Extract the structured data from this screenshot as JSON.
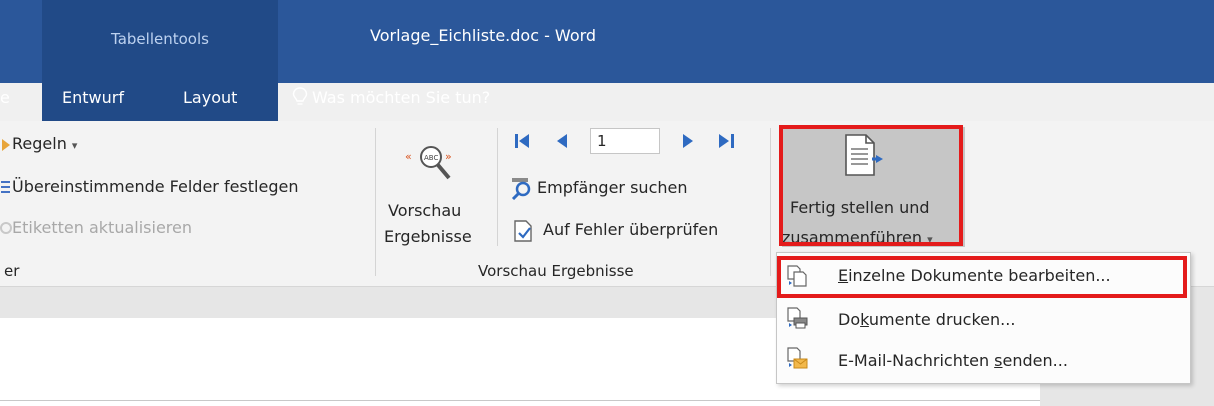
{
  "titlebar": {
    "context_tab": "Tabellentools",
    "title": "Vorlage_Eichliste.doc  -  Word"
  },
  "tabs": {
    "prev_fragment": "e",
    "entwurf": "Entwurf",
    "layout": "Layout",
    "tell_me": "Was möchten Sie tun?"
  },
  "ribbon": {
    "rules": "Regeln",
    "match_fields": "Übereinstimmende Felder festlegen",
    "update_labels": "Etiketten aktualisieren",
    "group_partial": "er",
    "preview_line1": "Vorschau",
    "preview_line2": "Ergebnisse",
    "record_number": "1",
    "find_recipient": "Empfänger suchen",
    "check_errors": "Auf Fehler überprüfen",
    "preview_group": "Vorschau Ergebnisse",
    "finish_line1": "Fertig stellen und",
    "finish_line2": "zusammenführen"
  },
  "menu": {
    "items": [
      {
        "pre": "",
        "key": "E",
        "post": "inzelne Dokumente bearbeiten..."
      },
      {
        "pre": "Do",
        "key": "k",
        "post": "umente drucken..."
      },
      {
        "pre": "E-Mail-Nachrichten ",
        "key": "s",
        "post": "enden..."
      }
    ]
  },
  "colors": {
    "titlebar": "#2b579a",
    "context_tab": "#214a87",
    "highlight": "#e41b1b",
    "finish_button": "#c6c6c6"
  }
}
